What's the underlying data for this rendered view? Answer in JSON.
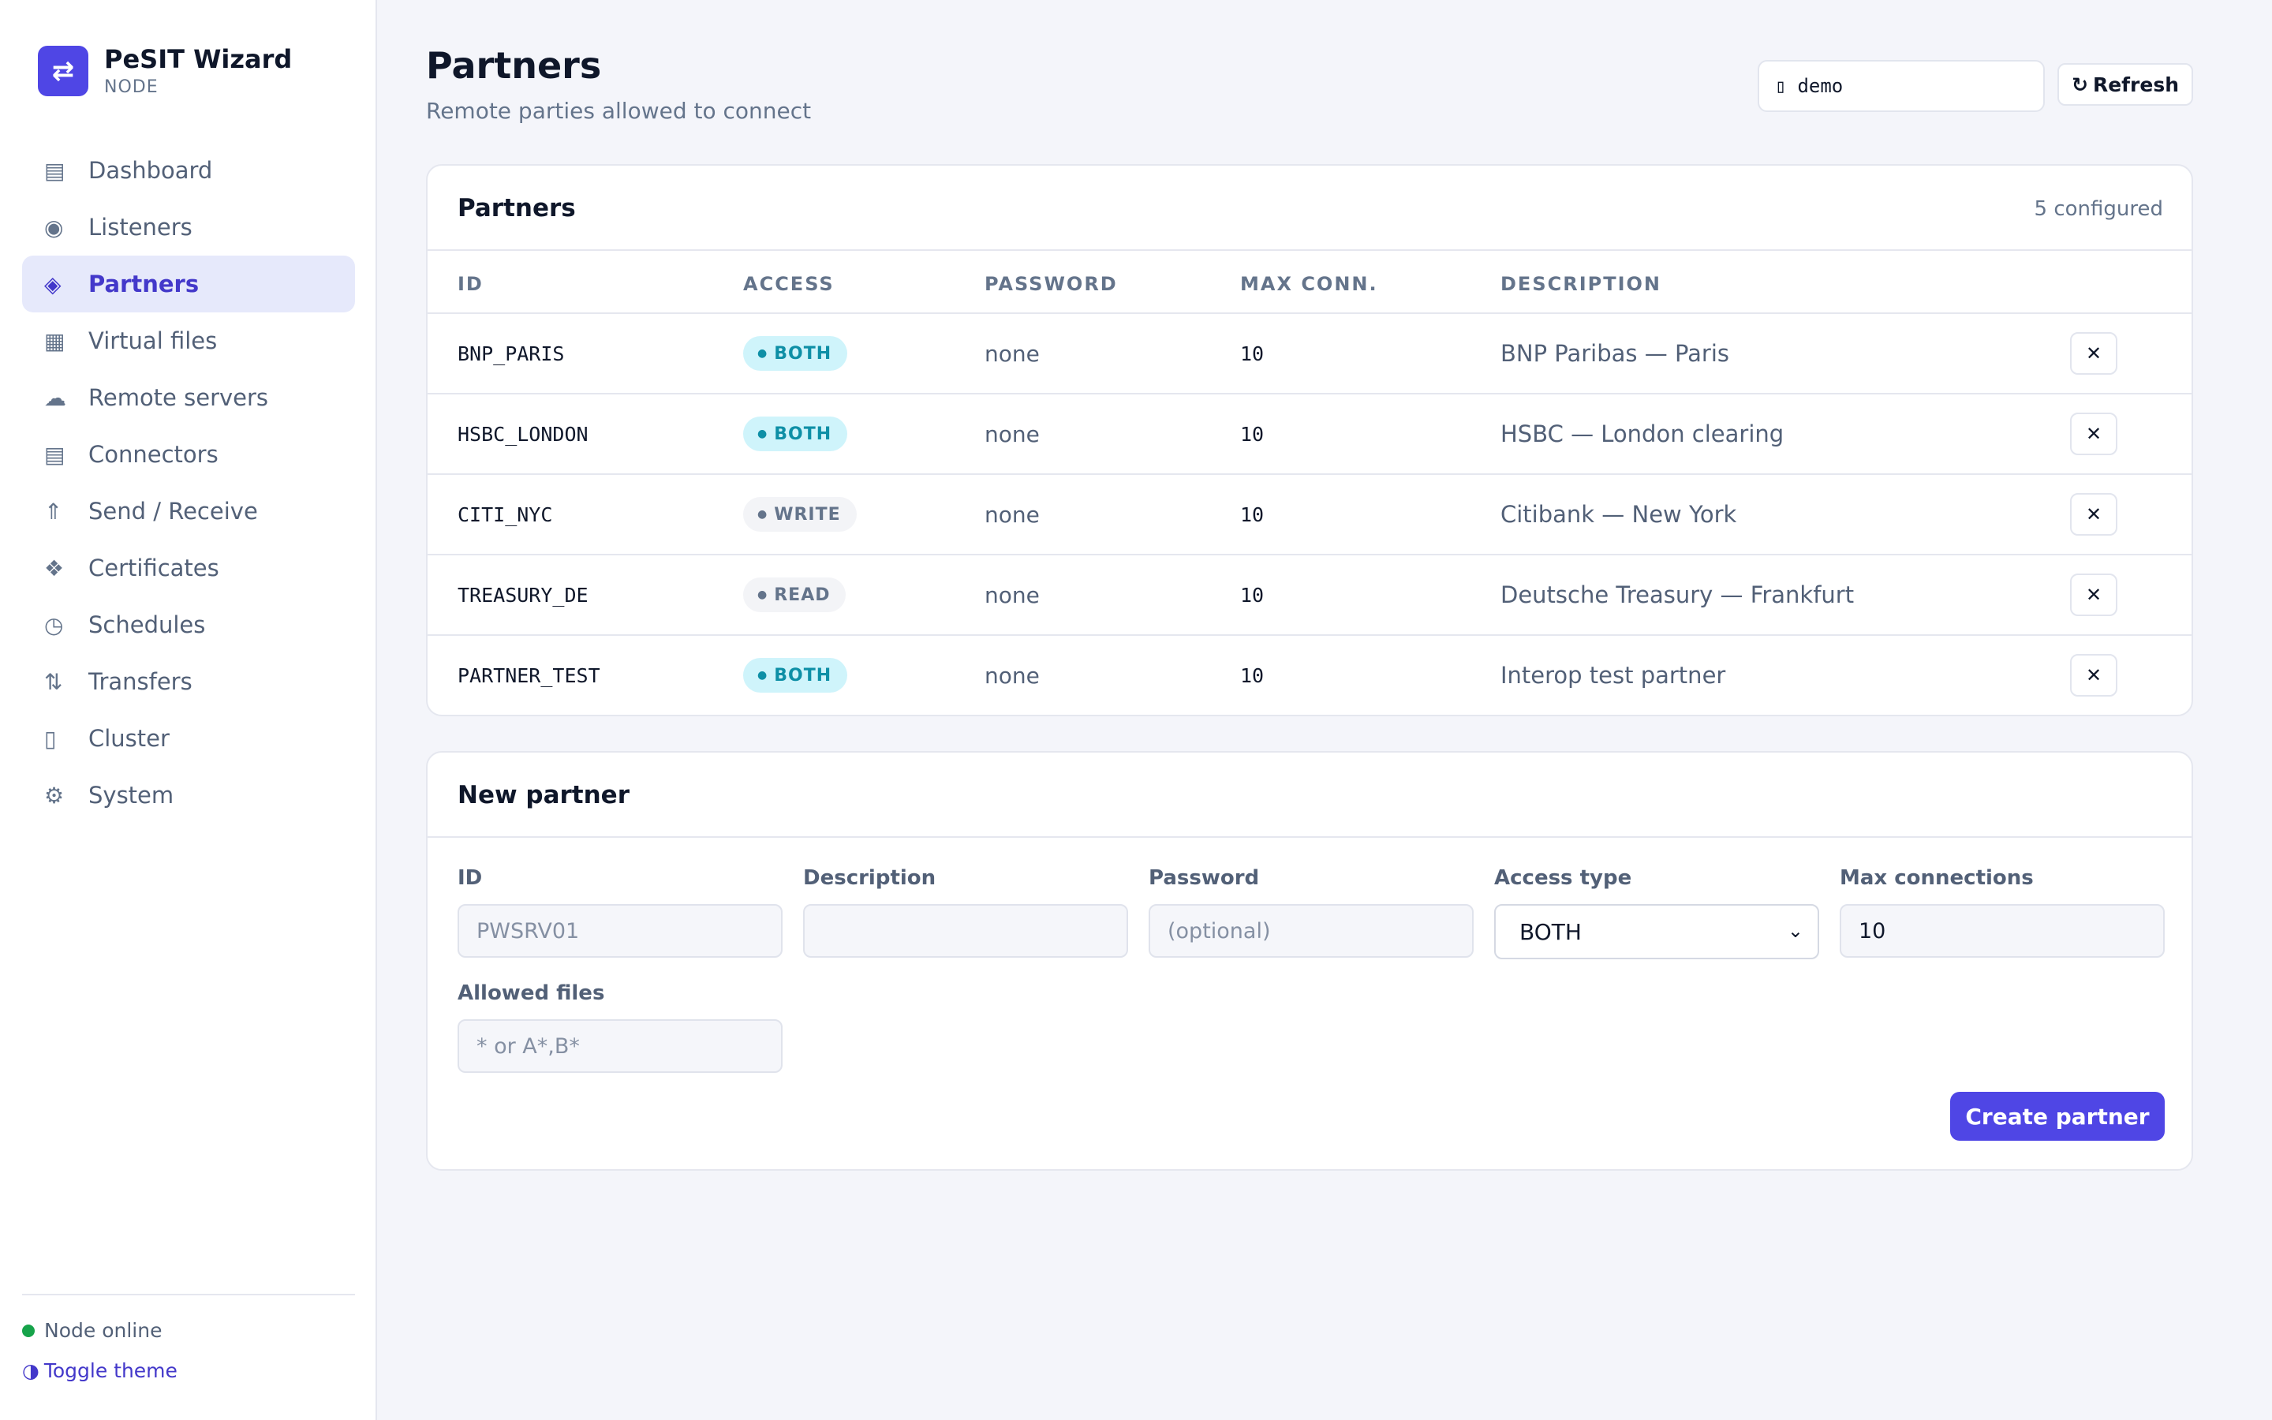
{
  "app": {
    "logo_glyph": "⇄",
    "title": "PeSIT Wizard",
    "subtitle": "NODE"
  },
  "sidebar": {
    "items": [
      {
        "icon": "▤",
        "icon_name": "dashboard-icon",
        "label": "Dashboard"
      },
      {
        "icon": "◉",
        "icon_name": "listeners-icon",
        "label": "Listeners"
      },
      {
        "icon": "◈",
        "icon_name": "partners-icon",
        "label": "Partners"
      },
      {
        "icon": "▦",
        "icon_name": "virtual-files-icon",
        "label": "Virtual files"
      },
      {
        "icon": "☁",
        "icon_name": "cloud-icon",
        "label": "Remote servers"
      },
      {
        "icon": "▤",
        "icon_name": "connectors-icon",
        "label": "Connectors"
      },
      {
        "icon": "⇑",
        "icon_name": "send-receive-icon",
        "label": "Send / Receive"
      },
      {
        "icon": "❖",
        "icon_name": "certificates-icon",
        "label": "Certificates"
      },
      {
        "icon": "◷",
        "icon_name": "clock-icon",
        "label": "Schedules"
      },
      {
        "icon": "⇅",
        "icon_name": "transfers-icon",
        "label": "Transfers"
      },
      {
        "icon": "▯",
        "icon_name": "cluster-icon",
        "label": "Cluster"
      },
      {
        "icon": "⚙",
        "icon_name": "gear-icon",
        "label": "System"
      }
    ],
    "active": "Partners",
    "status": {
      "label": "Node online",
      "color": "#16a34a"
    },
    "toggle_theme": {
      "icon": "◑",
      "label": "Toggle theme"
    }
  },
  "header": {
    "title": "Partners",
    "subtitle": "Remote parties allowed to connect",
    "node_input_icon": "▯",
    "node_input_value": "demo",
    "refresh_icon": "↻",
    "refresh_label": "Refresh"
  },
  "partners_card": {
    "title": "Partners",
    "count": "5 configured",
    "columns": [
      "ID",
      "ACCESS",
      "PASSWORD",
      "MAX CONN.",
      "DESCRIPTION"
    ],
    "rows": [
      {
        "id": "BNP_PARIS",
        "access": "BOTH",
        "password": "none",
        "max_conn": "10",
        "description": "BNP Paribas — Paris"
      },
      {
        "id": "HSBC_LONDON",
        "access": "BOTH",
        "password": "none",
        "max_conn": "10",
        "description": "HSBC — London clearing"
      },
      {
        "id": "CITI_NYC",
        "access": "WRITE",
        "password": "none",
        "max_conn": "10",
        "description": "Citibank — New York"
      },
      {
        "id": "TREASURY_DE",
        "access": "READ",
        "password": "none",
        "max_conn": "10",
        "description": "Deutsche Treasury — Frankfurt"
      },
      {
        "id": "PARTNER_TEST",
        "access": "BOTH",
        "password": "none",
        "max_conn": "10",
        "description": "Interop test partner"
      }
    ],
    "badge_dot": "●",
    "delete_glyph": "✕"
  },
  "new_partner": {
    "title": "New partner",
    "fields": {
      "id": {
        "label": "ID",
        "placeholder": "PWSRV01",
        "value": ""
      },
      "description": {
        "label": "Description",
        "placeholder": "",
        "value": ""
      },
      "password": {
        "label": "Password",
        "placeholder": "(optional)",
        "value": ""
      },
      "access_type": {
        "label": "Access type",
        "value": "BOTH"
      },
      "max_connections": {
        "label": "Max connections",
        "value": "10"
      },
      "allowed_files": {
        "label": "Allowed files",
        "placeholder": "* or A*,B*",
        "value": ""
      }
    },
    "select_chevron": "⌄",
    "create_label": "Create partner"
  },
  "colors": {
    "accent": "#4f46e5",
    "active_nav_bg": "#e6e9fb",
    "badge_both_bg": "#cff4fb",
    "badge_both_text": "#0e8fa6",
    "badge_neutral_bg": "#f3f4f7",
    "status_online": "#16a34a"
  }
}
